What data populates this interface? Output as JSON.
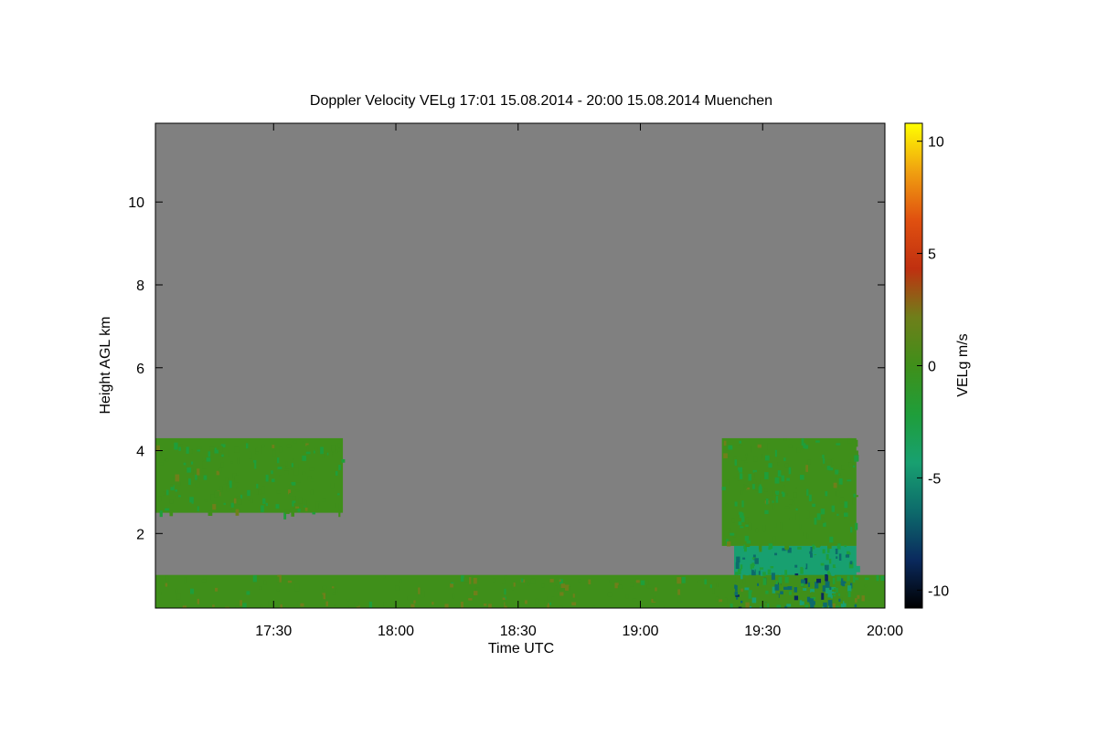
{
  "chart_data": {
    "type": "heatmap",
    "title": "Doppler Velocity VELg   17:01 15.08.2014 - 20:00 15.08.2014 Muenchen",
    "xlabel": "Time UTC",
    "ylabel": "Height AGL km",
    "colorbar_label": "VELg m/s",
    "x_range": [
      "17:01",
      "20:00"
    ],
    "x_ticks": [
      "17:30",
      "18:00",
      "18:30",
      "19:00",
      "19:30",
      "20:00"
    ],
    "y_range_km": [
      0.2,
      11.9
    ],
    "y_ticks": [
      2,
      4,
      6,
      8,
      10
    ],
    "color_range": [
      -10.8,
      10.8
    ],
    "colorbar_ticks": [
      10,
      5,
      0,
      -5,
      -10
    ],
    "colorbar_tick_labels": [
      "10",
      "5",
      "0",
      "-5",
      "-10"
    ],
    "background_color": "#808080",
    "colormap": [
      "#000000",
      "#0a2a5e",
      "#0d6b6b",
      "#18a070",
      "#1f9e3a",
      "#3f8f1a",
      "#6f7f1a",
      "#c03010",
      "#e05010",
      "#f0a010",
      "#ffff00"
    ],
    "cloud_regions": [
      {
        "name": "upper-cloud-left",
        "t_start": "17:01",
        "t_end": "17:47",
        "base_km": 2.5,
        "top_km": 4.3,
        "velocity_ms": -0.5
      },
      {
        "name": "upper-cloud-right",
        "t_start": "19:20",
        "t_end": "19:53",
        "base_km": 1.7,
        "top_km": 4.3,
        "velocity_ms": -0.8
      },
      {
        "name": "rain-layer",
        "t_start": "19:23",
        "t_end": "19:53",
        "base_km": 0.2,
        "top_km": 1.7,
        "velocity_ms": -4.5
      },
      {
        "name": "boundary-layer",
        "t_start": "17:01",
        "t_end": "20:00",
        "base_km": 0.2,
        "top_km": 1.0,
        "velocity_ms": 0.3
      }
    ]
  }
}
